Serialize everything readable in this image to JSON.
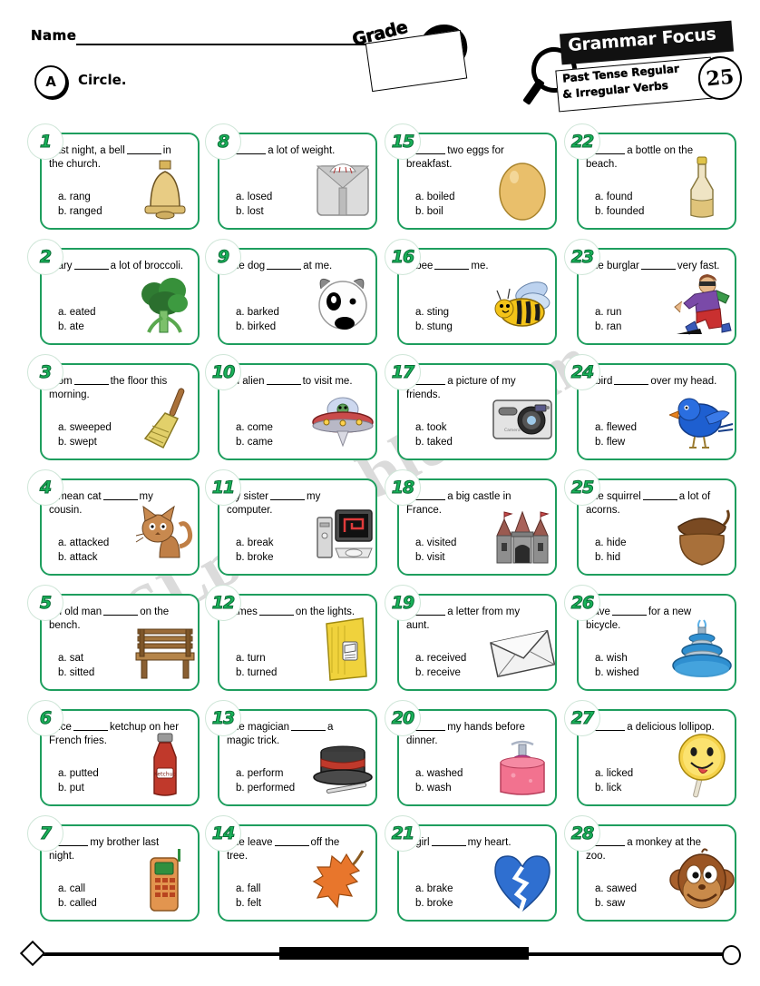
{
  "header": {
    "name_label": "Name",
    "instruction_badge": "A",
    "instruction_text": "Circle.",
    "grade_label": "Grade",
    "logo_title": "Grammar Focus",
    "logo_subtitle_line1": "Past Tense Regular",
    "logo_subtitle_line2": "& Irregular Verbs",
    "logo_number": "25"
  },
  "watermark": "ESLprintables.com",
  "colors": {
    "box_border": "#1e9e5e",
    "badge_number": "#19b259",
    "text": "#000000"
  },
  "items": [
    {
      "n": "1",
      "text_before": "Last night, a bell",
      "text_after": "in the church.",
      "a": "a. rang",
      "b": "b. ranged",
      "art": "bell-icon"
    },
    {
      "n": "2",
      "text_before": "Mary",
      "text_after": "a lot of broccoli.",
      "a": "a. eated",
      "b": "b. ate",
      "art": "broccoli-icon"
    },
    {
      "n": "3",
      "text_before": "Mom",
      "text_after": "the floor this morning.",
      "a": "a. sweeped",
      "b": "b. swept",
      "art": "broom-icon"
    },
    {
      "n": "4",
      "text_before": "A mean cat",
      "text_after": "my cousin.",
      "a": "a. attacked",
      "b": "b. attack",
      "art": "cat-icon"
    },
    {
      "n": "5",
      "text_before": "An old man",
      "text_after": "on the bench.",
      "a": "a. sat",
      "b": "b. sitted",
      "art": "bench-icon"
    },
    {
      "n": "6",
      "text_before": "Alice",
      "text_after": "ketchup on her French fries.",
      "a": "a. putted",
      "b": "b. put",
      "art": "ketchup-icon"
    },
    {
      "n": "7",
      "text_before": "I",
      "text_after": "my brother last night.",
      "a": "a. call",
      "b": "b. called",
      "art": "mobile-phone-icon"
    },
    {
      "n": "8",
      "text_before": "I",
      "text_after": "a lot of weight.",
      "a": "a. losed",
      "b": "b. lost",
      "art": "scale-icon"
    },
    {
      "n": "9",
      "text_before": "The dog",
      "text_after": "at me.",
      "a": "a. barked",
      "b": "b. birked",
      "art": "dog-icon"
    },
    {
      "n": "10",
      "text_before": "An alien",
      "text_after": "to visit me.",
      "a": "a. come",
      "b": "b. came",
      "art": "ufo-icon"
    },
    {
      "n": "11",
      "text_before": "My sister",
      "text_after": "my computer.",
      "a": "a. break",
      "b": "b. broke",
      "art": "computer-icon"
    },
    {
      "n": "12",
      "text_before": "James",
      "text_after": "on the lights.",
      "a": "a. turn",
      "b": "b. turned",
      "art": "light-switch-icon"
    },
    {
      "n": "13",
      "text_before": "The magician",
      "text_after": "a magic trick.",
      "a": "a. perform",
      "b": "b. performed",
      "art": "magic-hat-icon"
    },
    {
      "n": "14",
      "text_before": "The leave",
      "text_after": "off the tree.",
      "a": "a. fall",
      "b": "b. felt",
      "art": "leaf-icon"
    },
    {
      "n": "15",
      "text_before": "I",
      "text_after": "two eggs for breakfast.",
      "a": "a. boiled",
      "b": "b. boil",
      "art": "egg-icon"
    },
    {
      "n": "16",
      "text_before": "A bee",
      "text_after": "me.",
      "a": "a. sting",
      "b": "b. stung",
      "art": "bee-icon"
    },
    {
      "n": "17",
      "text_before": "I",
      "text_after": "a picture of my friends.",
      "a": "a. took",
      "b": "b. taked",
      "art": "camera-icon"
    },
    {
      "n": "18",
      "text_before": "I",
      "text_after": "a big castle in France.",
      "a": "a. visited",
      "b": "b. visit",
      "art": "castle-icon"
    },
    {
      "n": "19",
      "text_before": "I",
      "text_after": "a letter from my aunt.",
      "a": "a. received",
      "b": "b. receive",
      "art": "envelope-icon"
    },
    {
      "n": "20",
      "text_before": "I",
      "text_after": "my hands before dinner.",
      "a": "a. washed",
      "b": "b. wash",
      "art": "soap-dispenser-icon"
    },
    {
      "n": "21",
      "text_before": "A girl",
      "text_after": "my heart.",
      "a": "a. brake",
      "b": "b. broke",
      "art": "broken-heart-icon"
    },
    {
      "n": "22",
      "text_before": "I",
      "text_after": "a bottle on the beach.",
      "a": "a. found",
      "b": "b. founded",
      "art": "bottle-icon"
    },
    {
      "n": "23",
      "text_before": "The burglar",
      "text_after": "very fast.",
      "a": "a. run",
      "b": "b. ran",
      "art": "running-burglar-icon"
    },
    {
      "n": "24",
      "text_before": "A bird",
      "text_after": "over my head.",
      "a": "a. flewed",
      "b": "b. flew",
      "art": "bird-icon"
    },
    {
      "n": "25",
      "text_before": "The squirrel",
      "text_after": "a lot of acorns.",
      "a": "a. hide",
      "b": "b. hid",
      "art": "acorn-icon"
    },
    {
      "n": "26",
      "text_before": "Dave",
      "text_after": "for a new bicycle.",
      "a": "a. wish",
      "b": "b. wished",
      "art": "fountain-icon"
    },
    {
      "n": "27",
      "text_before": "I",
      "text_after": "a delicious lollipop.",
      "a": "a. licked",
      "b": "b. lick",
      "art": "lollipop-icon"
    },
    {
      "n": "28",
      "text_before": "I",
      "text_after": "a monkey at the zoo.",
      "a": "a. sawed",
      "b": "b. saw",
      "art": "monkey-icon"
    }
  ]
}
